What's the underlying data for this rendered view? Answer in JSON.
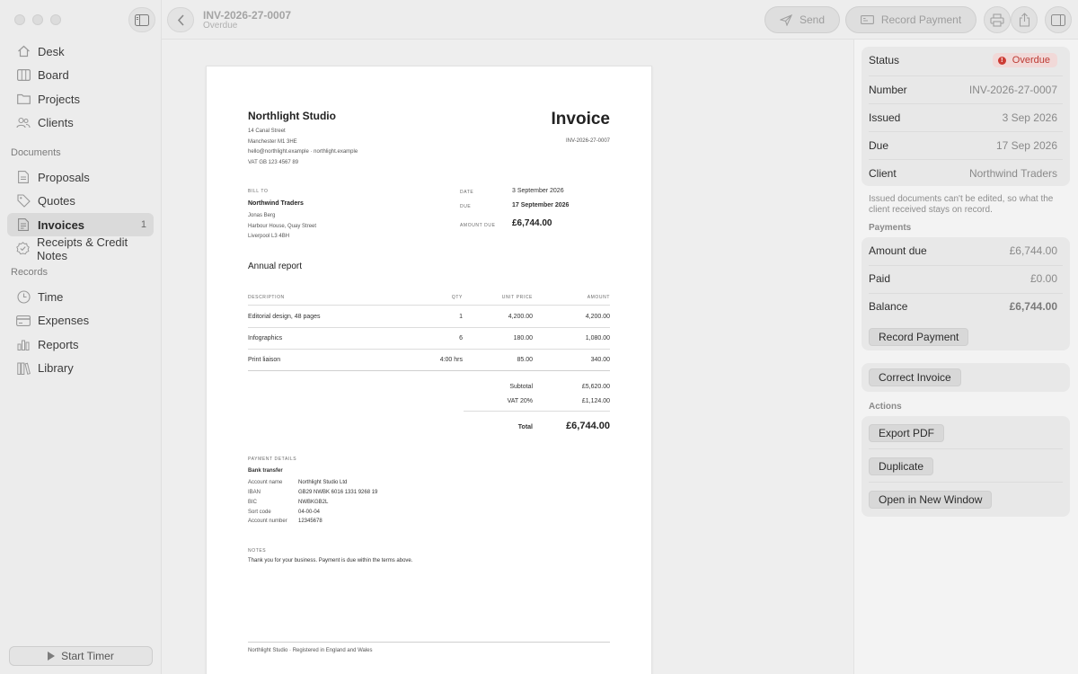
{
  "sidebar": {
    "items": [
      {
        "label": "Desk",
        "icon": "house-icon"
      },
      {
        "label": "Board",
        "icon": "board-icon"
      },
      {
        "label": "Projects",
        "icon": "folder-icon"
      },
      {
        "label": "Clients",
        "icon": "people-icon"
      }
    ],
    "documents_label": "Documents",
    "documents": [
      {
        "label": "Proposals",
        "icon": "document-icon"
      },
      {
        "label": "Quotes",
        "icon": "tag-icon"
      },
      {
        "label": "Invoices",
        "icon": "invoice-icon",
        "count": "1",
        "active": true
      },
      {
        "label": "Receipts & Credit Notes",
        "icon": "checkmark-badge-icon"
      }
    ],
    "records_label": "Records",
    "records": [
      {
        "label": "Time",
        "icon": "clock-icon"
      },
      {
        "label": "Expenses",
        "icon": "card-icon"
      },
      {
        "label": "Reports",
        "icon": "bar-chart-icon"
      },
      {
        "label": "Library",
        "icon": "books-icon"
      }
    ],
    "start_timer": "Start Timer"
  },
  "toolbar": {
    "title": "INV-2026-27-0007",
    "subtitle": "Overdue",
    "send": "Send",
    "record_payment": "Record Payment"
  },
  "invoice": {
    "company": "Northlight Studio",
    "company_address": [
      "14 Canal Street",
      "Manchester M1 3HE",
      "hello@northlight.example  ·  northlight.example",
      "VAT GB 123 4567 89"
    ],
    "heading": "Invoice",
    "number": "INV-2026-27-0007",
    "bill_to_label": "BILL TO",
    "bill_to_name": "Northwind Traders",
    "bill_to_address": [
      "Jonas Berg",
      "Harbour House, Quay Street",
      "Liverpool L3 4BH"
    ],
    "date_label": "DATE",
    "date": "3 September 2026",
    "due_label": "DUE",
    "due": "17 September 2026",
    "amount_due_label": "AMOUNT DUE",
    "amount_due": "£6,744.00",
    "project": "Annual report",
    "columns": {
      "description": "DESCRIPTION",
      "qty": "QTY",
      "unit_price": "UNIT PRICE",
      "amount": "AMOUNT"
    },
    "lines": [
      {
        "description": "Editorial design, 48 pages",
        "qty": "1",
        "unit_price": "4,200.00",
        "amount": "4,200.00"
      },
      {
        "description": "Infographics",
        "qty": "6",
        "unit_price": "180.00",
        "amount": "1,080.00"
      },
      {
        "description": "Print liaison",
        "qty": "4:00 hrs",
        "unit_price": "85.00",
        "amount": "340.00"
      }
    ],
    "subtotal_label": "Subtotal",
    "subtotal": "£5,620.00",
    "vat_label": "VAT 20%",
    "vat": "£1,124.00",
    "total_label": "Total",
    "total": "£6,744.00",
    "payment_details_label": "PAYMENT DETAILS",
    "payment_method": "Bank transfer",
    "payment": [
      {
        "label": "Account name",
        "value": "Northlight Studio Ltd"
      },
      {
        "label": "IBAN",
        "value": "GB29 NWBK 6016 1331 9268 19"
      },
      {
        "label": "BIC",
        "value": "NWBKGB2L"
      },
      {
        "label": "Sort code",
        "value": "04-00-04"
      },
      {
        "label": "Account number",
        "value": "12345678"
      }
    ],
    "notes_label": "NOTES",
    "notes": "Thank you for your business. Payment is due within the terms above.",
    "footer": "Northlight Studio · Registered in England and Wales"
  },
  "panel": {
    "status_label": "Status",
    "status": "Overdue",
    "status_color": "#cc3b34",
    "number_label": "Number",
    "number": "INV-2026-27-0007",
    "issued_label": "Issued",
    "issued": "3 Sep 2026",
    "due_label": "Due",
    "due": "17 Sep 2026",
    "client_label": "Client",
    "client": "Northwind Traders",
    "note": "Issued documents can't be edited, so what the client received stays on record.",
    "payments_label": "Payments",
    "amount_due_label": "Amount due",
    "amount_due": "£6,744.00",
    "paid_label": "Paid",
    "paid": "£0.00",
    "balance_label": "Balance",
    "balance": "£6,744.00",
    "record_payment": "Record Payment",
    "correct_invoice": "Correct Invoice",
    "actions_label": "Actions",
    "export_pdf": "Export PDF",
    "duplicate": "Duplicate",
    "open_new_window": "Open in New Window"
  }
}
